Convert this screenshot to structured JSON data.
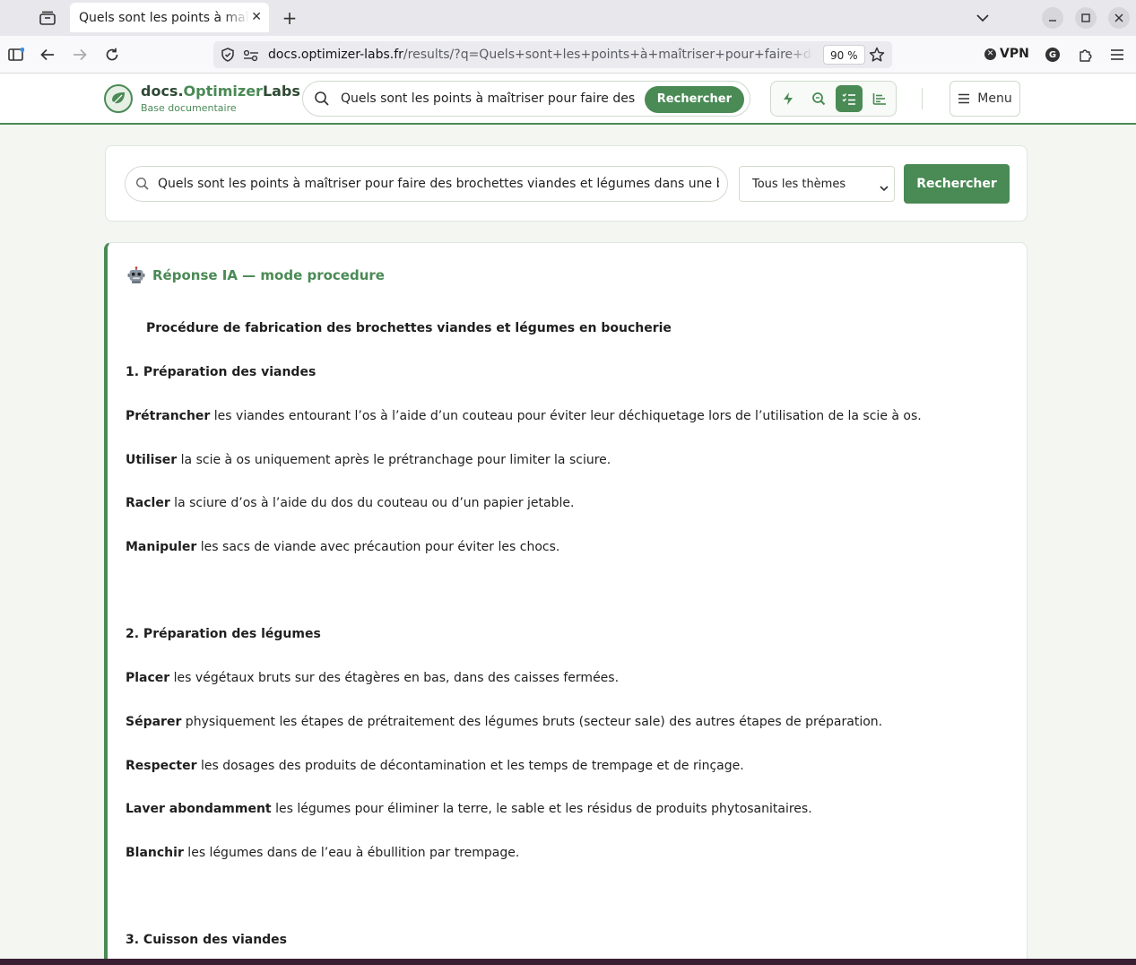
{
  "browser": {
    "tab_title": "Quels sont les points à maîtriser pour faire des brochettes",
    "tab_close": "✕",
    "new_tab": "+",
    "url_host": "docs.optimizer-labs.fr",
    "url_path": "/results/?q=Quels+sont+les+points+à+maîtriser+pour+faire+des+brochettes",
    "zoom": "90 %",
    "vpn_label": "VPN",
    "profile_letter": "G"
  },
  "site": {
    "logo_prefix": "docs.",
    "logo_accent_1": "Optimizer",
    "logo_accent_2": "Labs",
    "logo_subtitle": "Base documentaire",
    "header_search_value": "Quels sont les points à maîtriser pour faire des brochettes",
    "header_search_button": "Rechercher",
    "menu_label": "Menu"
  },
  "search": {
    "query": "Quels sont les points à maîtriser pour faire des brochettes viandes et légumes dans une boucherie",
    "theme_selected": "Tous les thèmes",
    "button": "Rechercher"
  },
  "answer": {
    "header": "Réponse IA — mode procedure",
    "title": "Procédure de fabrication des brochettes viandes et légumes en boucherie",
    "sections": [
      {
        "heading": "1. Préparation des viandes",
        "items": [
          {
            "verb": "Prétrancher",
            "text": " les viandes entourant l’os à l’aide d’un couteau pour éviter leur déchiquetage lors de l’utilisation de la scie à os."
          },
          {
            "verb": "Utiliser",
            "text": " la scie à os uniquement après le prétranchage pour limiter la sciure."
          },
          {
            "verb": "Racler",
            "text": " la sciure d’os à l’aide du dos du couteau ou d’un papier jetable."
          },
          {
            "verb": "Manipuler",
            "text": " les sacs de viande avec précaution pour éviter les chocs."
          }
        ]
      },
      {
        "heading": "2. Préparation des légumes",
        "items": [
          {
            "verb": "Placer",
            "text": " les végétaux bruts sur des étagères en bas, dans des caisses fermées."
          },
          {
            "verb": "Séparer",
            "text": " physiquement les étapes de prétraitement des légumes bruts (secteur sale) des autres étapes de préparation."
          },
          {
            "verb": "Respecter",
            "text": " les dosages des produits de décontamination et les temps de trempage et de rinçage."
          },
          {
            "verb": "Laver abondamment",
            "text": " les légumes pour éliminer la terre, le sable et les résidus de produits phytosanitaires."
          },
          {
            "verb": "Blanchir",
            "text": " les légumes dans de l’eau à ébullition par trempage."
          }
        ]
      },
      {
        "heading": "3. Cuisson des viandes",
        "items": []
      }
    ]
  },
  "colors": {
    "brand_green": "#4a8a55",
    "page_bg": "#f3f6f1"
  }
}
